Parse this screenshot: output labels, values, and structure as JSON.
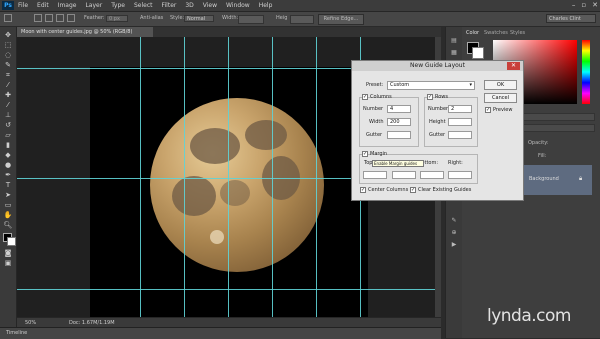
{
  "menubar": {
    "logo": "Ps",
    "items": [
      "File",
      "Edit",
      "Image",
      "Layer",
      "Type",
      "Select",
      "Filter",
      "3D",
      "View",
      "Window",
      "Help"
    ]
  },
  "options": {
    "feather_label": "Feather:",
    "feather_value": "0 px",
    "antialias_label": "Anti-alias",
    "style_label": "Style:",
    "style_value": "Normal",
    "width_label": "Width:",
    "height_label": "Heig",
    "refine_label": "Refine Edge...",
    "workspace": "Charles Clint"
  },
  "document": {
    "tab_title": "Moon with center guides.jpg @ 50% (RGB/8)",
    "zoom": "50%",
    "doc_info": "Doc: 1.67M/1.19M",
    "timeline": "Timeline"
  },
  "panels": {
    "tabs": [
      "Color",
      "Swatches",
      "Styles"
    ],
    "opacity_label": "Opacity:",
    "fill_label": "Fill:",
    "layer_name": "Background"
  },
  "dialog": {
    "title": "New Guide Layout",
    "preset_label": "Preset:",
    "preset_value": "Custom",
    "columns_label": "Columns",
    "rows_label": "Rows",
    "number_label": "Number",
    "width_label": "Width",
    "height_label": "Height",
    "gutter_label": "Gutter",
    "columns_number": "4",
    "columns_width": "200",
    "rows_number": "2",
    "margin_label": "Margin",
    "top_label": "Top",
    "bottom_label": "Bottom:",
    "right_label": "Right:",
    "center_columns": "Center Columns",
    "clear_guides": "Clear Existing Guides",
    "ok": "OK",
    "cancel": "Cancel",
    "preview": "Preview",
    "tooltip": "Enable Margin guides",
    "checked": {
      "columns": true,
      "rows": true,
      "margin": true,
      "center_columns": true,
      "clear_guides": true,
      "preview": true
    }
  },
  "watermark": "lynda.com",
  "colors": {
    "guide": "#5fd3d6",
    "dialog_bg": "#e5e5e5",
    "accent": "#31a8ff"
  }
}
